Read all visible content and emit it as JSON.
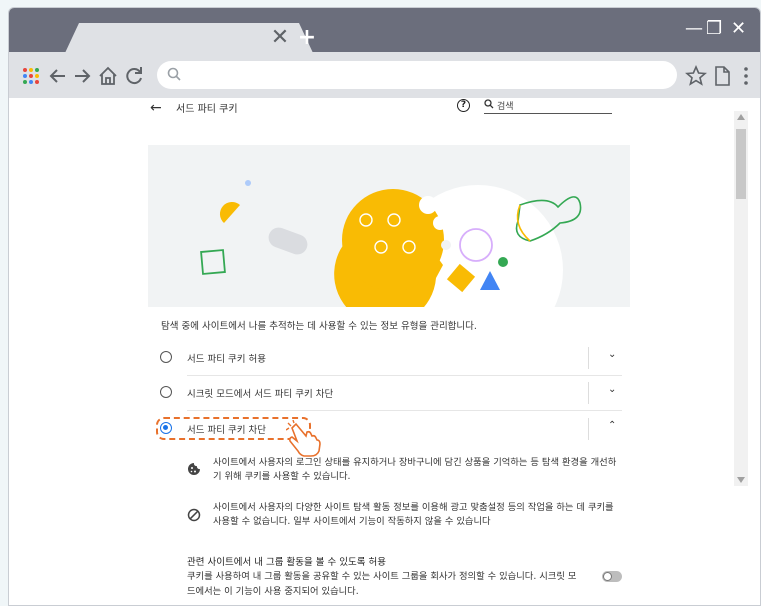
{
  "window": {
    "tab_close_glyph": "✕",
    "new_tab_glyph": "+",
    "minimize_glyph": "—",
    "restore_glyph": "❐",
    "close_glyph": "✕"
  },
  "toolbar": {
    "icons": [
      "apps-grid-icon",
      "back-arrow-icon",
      "forward-arrow-icon",
      "home-icon",
      "reload-icon",
      "star-icon",
      "page-icon",
      "menu-dots-icon"
    ],
    "omnibox_value": ""
  },
  "header": {
    "back_glyph": "←",
    "title": "서드 파티 쿠키",
    "help_glyph": "?",
    "search_placeholder": "검색"
  },
  "description": "탐색 중에 사이트에서 나를 추적하는 데 사용할 수 있는 정보 유형을 관리합니다.",
  "options": [
    {
      "label": "서드 파티 쿠키 허용",
      "selected": false,
      "expand_glyph": "⌄"
    },
    {
      "label": "시크릿 모드에서 서드 파티 쿠키 차단",
      "selected": false,
      "expand_glyph": "⌄"
    },
    {
      "label": "서드 파티 쿠키 차단",
      "selected": true,
      "expand_glyph": "⌃"
    }
  ],
  "details": [
    {
      "icon": "cookie-icon",
      "text": "사이트에서 사용자의 로그인 상태를 유지하거나 장바구니에 담긴 상품을 기억하는 등 탐색 환경을 개선하기 위해 쿠키를 사용할 수 있습니다."
    },
    {
      "icon": "block-icon",
      "text": "사이트에서 사용자의 다양한 사이트 탐색 활동 정보를 이용해 광고 맞춤설정 등의 작업을 하는 데 쿠키를 사용할 수 없습니다. 일부 사이트에서 기능이 작동하지 않을 수 있습니다"
    }
  ],
  "related": {
    "title": "관련 사이트에서 내 그룹 활동을 볼 수 있도록 허용",
    "description": "쿠키를 사용하여 내 그룹 활동을 공유할 수 있는 사이트 그룹을 회사가 정의할 수 있습니다. 시크릿 모드에서는 이 기능이 사용 중지되어 있습니다.",
    "toggle_on": false
  },
  "colors": {
    "accent": "#1a73e8",
    "cookie": "#f9bb04",
    "highlight": "#e8712c"
  }
}
